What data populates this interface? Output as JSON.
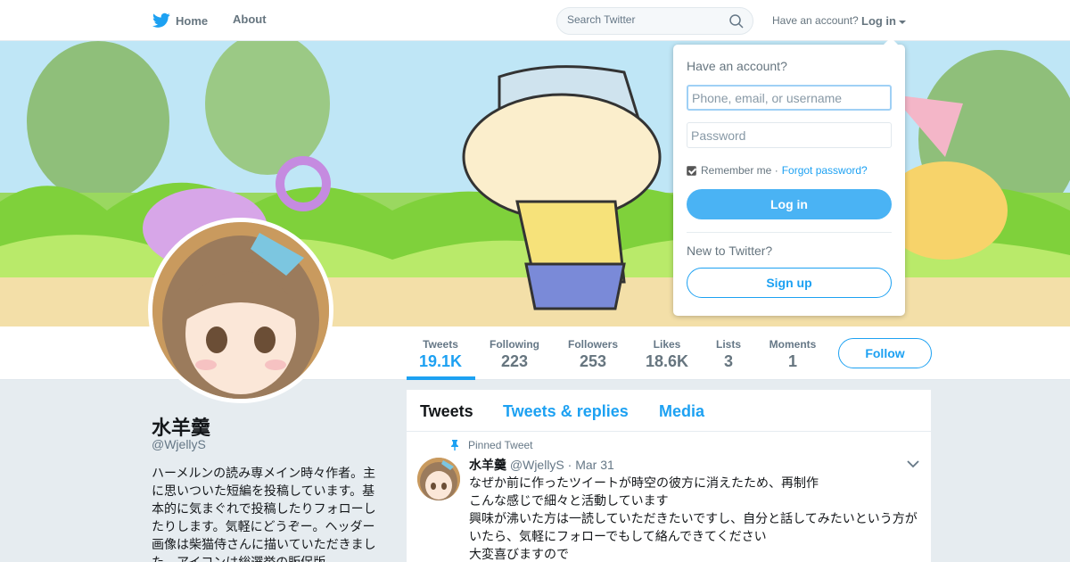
{
  "nav": {
    "home_label": "Home",
    "about_label": "About",
    "search_placeholder": "Search Twitter",
    "have_account_text": "Have an account?",
    "login_label": "Log in"
  },
  "profile": {
    "name": "水羊羹",
    "handle": "@WjellyS",
    "bio": "ハーメルンの読み専メイン時々作者。主に思いついた短編を投稿しています。基本的に気まぐれで投稿したりフォローしたりします。気軽にどうぞー。ヘッダー画像は柴猫侍さんに描いていただきました。アイコンは総選挙の販促版…"
  },
  "stats": [
    {
      "label": "Tweets",
      "value": "19.1K"
    },
    {
      "label": "Following",
      "value": "223"
    },
    {
      "label": "Followers",
      "value": "253"
    },
    {
      "label": "Likes",
      "value": "18.6K"
    },
    {
      "label": "Lists",
      "value": "3"
    },
    {
      "label": "Moments",
      "value": "1"
    }
  ],
  "follow_label": "Follow",
  "tabs": [
    "Tweets",
    "Tweets & replies",
    "Media"
  ],
  "tweet": {
    "pinned_label": "Pinned Tweet",
    "author": "水羊羹",
    "handle": "@WjellyS",
    "date": "· Mar 31",
    "lines": [
      "なぜか前に作ったツイートが時空の彼方に消えたため、再制作",
      "こんな感じで細々と活動しています",
      "興味が沸いた方は一読していただきたいですし、自分と話してみたいという方がいたら、気軽にフォローでもして絡んできてください",
      "大変喜びますので"
    ]
  },
  "login_dropdown": {
    "title": "Have an account?",
    "username_placeholder": "Phone, email, or username",
    "password_placeholder": "Password",
    "remember_label": "Remember me ·",
    "forgot_label": "Forgot password?",
    "login_button": "Log in",
    "new_to_twitter": "New to Twitter?",
    "signup_button": "Sign up"
  },
  "colors": {
    "accent": "#1da1f2",
    "login_button_bg": "#4ab3f4",
    "page_bg": "#e6ecf0"
  },
  "icons": [
    "twitter-bird-icon",
    "search-icon",
    "pin-icon",
    "chevron-down-icon"
  ]
}
